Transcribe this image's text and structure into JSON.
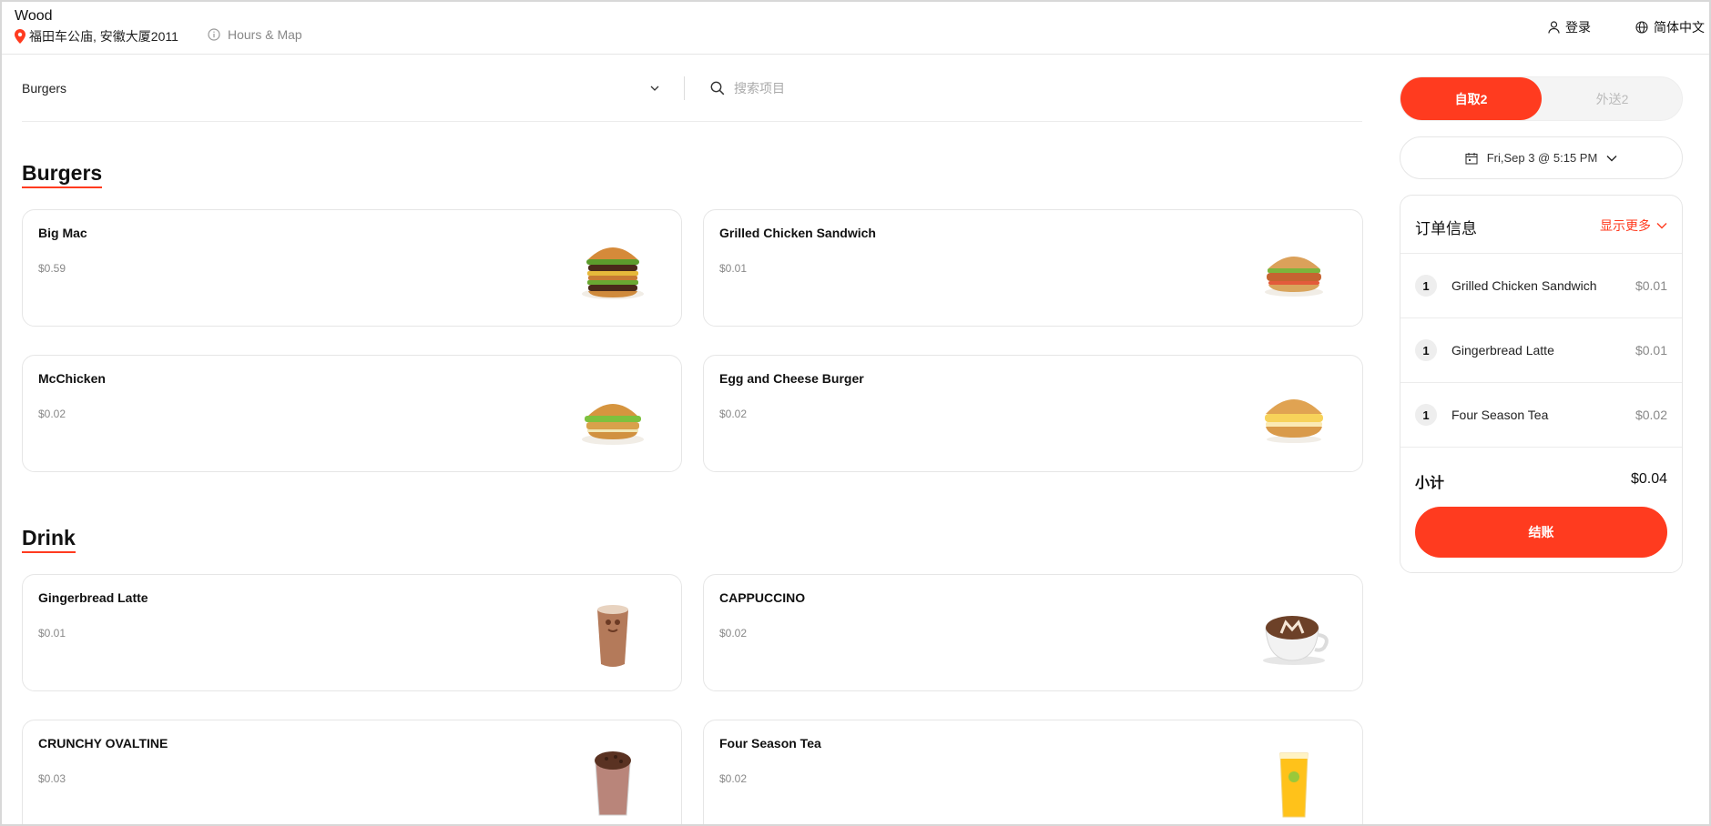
{
  "header": {
    "store_name": "Wood",
    "store_address": "福田车公庙, 安徽大厦2011",
    "hours_link": "Hours & Map",
    "login_label": "登录",
    "language_label": "简体中文"
  },
  "filter": {
    "category_selected": "Burgers",
    "search_placeholder": "搜索项目"
  },
  "sections": [
    {
      "title": "Burgers",
      "items": [
        {
          "name": "Big Mac",
          "price": "$0.59",
          "icon": "big-mac"
        },
        {
          "name": "Grilled Chicken Sandwich",
          "price": "$0.01",
          "icon": "chicken-sandwich"
        },
        {
          "name": "McChicken",
          "price": "$0.02",
          "icon": "mcchicken"
        },
        {
          "name": "Egg and Cheese Burger",
          "price": "$0.02",
          "icon": "egg-cheese-burger"
        }
      ]
    },
    {
      "title": "Drink",
      "items": [
        {
          "name": "Gingerbread Latte",
          "price": "$0.01",
          "icon": "latte-glass"
        },
        {
          "name": "CAPPUCCINO",
          "price": "$0.02",
          "icon": "cappuccino-cup"
        },
        {
          "name": "CRUNCHY OVALTINE",
          "price": "$0.03",
          "icon": "ovaltine-glass"
        },
        {
          "name": "Four Season Tea",
          "price": "$0.02",
          "icon": "tea-glass"
        }
      ]
    }
  ],
  "order_mode": {
    "pickup_label": "自取2",
    "delivery_label": "外送2",
    "selected": "pickup"
  },
  "pickup_time": "Fri,Sep 3 @ 5:15 PM",
  "order": {
    "title": "订单信息",
    "show_more_label": "显示更多",
    "items": [
      {
        "qty": "1",
        "name": "Grilled Chicken Sandwich",
        "price": "$0.01"
      },
      {
        "qty": "1",
        "name": "Gingerbread Latte",
        "price": "$0.01"
      },
      {
        "qty": "1",
        "name": "Four Season Tea",
        "price": "$0.02"
      }
    ],
    "subtotal_label": "小计",
    "subtotal_value": "$0.04",
    "checkout_label": "结账"
  },
  "colors": {
    "accent": "#ff3b1f",
    "border": "#e6e6e6",
    "muted_text": "#888888"
  }
}
